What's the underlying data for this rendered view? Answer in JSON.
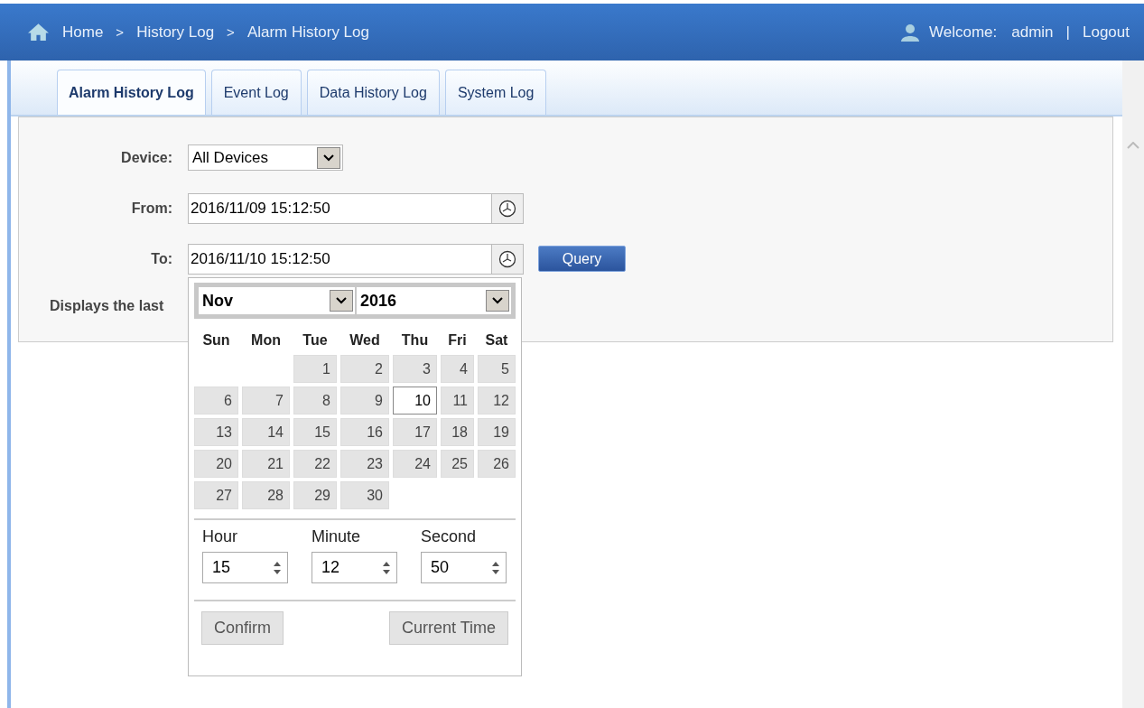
{
  "header": {
    "breadcrumb": [
      "Home",
      "History Log",
      "Alarm History Log"
    ],
    "separator": ">",
    "welcome_label": "Welcome:",
    "user": "admin",
    "divider": "|",
    "logout": "Logout"
  },
  "tabs": [
    {
      "label": "Alarm History Log",
      "selected": true
    },
    {
      "label": "Event Log",
      "selected": false
    },
    {
      "label": "Data History Log",
      "selected": false
    },
    {
      "label": "System Log",
      "selected": false
    }
  ],
  "form": {
    "device_label": "Device:",
    "device_value": "All Devices",
    "from_label": "From:",
    "from_value": "2016/11/09 15:12:50",
    "to_label": "To:",
    "to_value": "2016/11/10 15:12:50",
    "query_button": "Query",
    "displays_text": "Displays the last"
  },
  "date_picker": {
    "month": "Nov",
    "year": "2016",
    "weekdays": [
      "Sun",
      "Mon",
      "Tue",
      "Wed",
      "Thu",
      "Fri",
      "Sat"
    ],
    "weeks": [
      [
        {
          "day": "1",
          "selected": false
        },
        {
          "day": "2",
          "selected": false
        },
        {
          "day": "3",
          "selected": false
        },
        {
          "day": "4",
          "selected": false
        },
        {
          "day": "5",
          "selected": false
        }
      ],
      [
        {
          "day": "6",
          "selected": false
        },
        {
          "day": "7",
          "selected": false
        },
        {
          "day": "8",
          "selected": false
        },
        {
          "day": "9",
          "selected": false
        },
        {
          "day": "10",
          "selected": true
        },
        {
          "day": "11",
          "selected": false
        },
        {
          "day": "12",
          "selected": false
        }
      ],
      [
        {
          "day": "13",
          "selected": false
        },
        {
          "day": "14",
          "selected": false
        },
        {
          "day": "15",
          "selected": false
        },
        {
          "day": "16",
          "selected": false
        },
        {
          "day": "17",
          "selected": false
        },
        {
          "day": "18",
          "selected": false
        },
        {
          "day": "19",
          "selected": false
        }
      ],
      [
        {
          "day": "20",
          "selected": false
        },
        {
          "day": "21",
          "selected": false
        },
        {
          "day": "22",
          "selected": false
        },
        {
          "day": "23",
          "selected": false
        },
        {
          "day": "24",
          "selected": false
        },
        {
          "day": "25",
          "selected": false
        },
        {
          "day": "26",
          "selected": false
        }
      ],
      [
        {
          "day": "27",
          "selected": false
        },
        {
          "day": "28",
          "selected": false
        },
        {
          "day": "29",
          "selected": false
        },
        {
          "day": "30",
          "selected": false
        }
      ]
    ],
    "time_fields": [
      {
        "label": "Hour",
        "value": "15"
      },
      {
        "label": "Minute",
        "value": "12"
      },
      {
        "label": "Second",
        "value": "50"
      }
    ],
    "buttons": [
      "Confirm",
      "Current Time"
    ]
  }
}
